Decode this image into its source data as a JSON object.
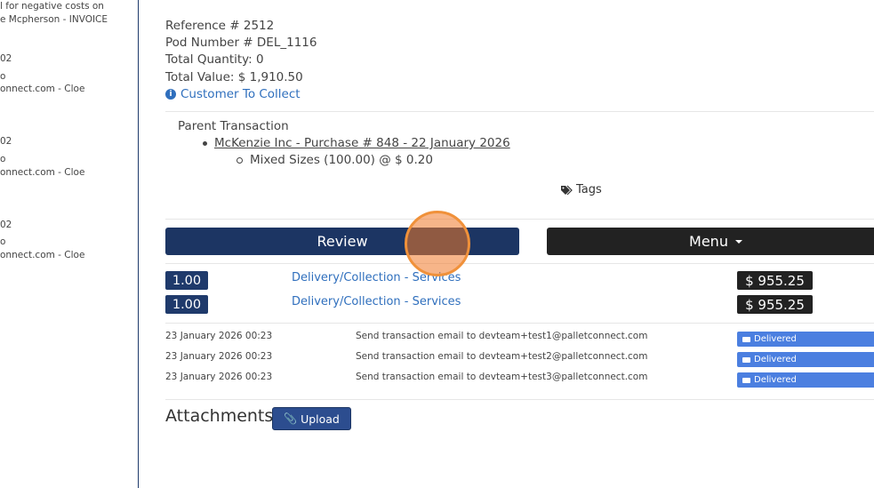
{
  "left_panel": {
    "lines": [
      "l for negative costs on",
      "e Mcpherson - INVOICE",
      "02",
      "o",
      "onnect.com - Cloe",
      "02",
      "o",
      "onnect.com - Cloe",
      "02",
      "o",
      "onnect.com - Cloe"
    ]
  },
  "details": {
    "reference": "Reference # 2512",
    "pod_number": "Pod Number # DEL_1116",
    "total_quantity": "Total Quantity: 0",
    "total_value": "Total Value: $ 1,910.50",
    "customer_collect": "Customer To Collect",
    "info_icon": "i"
  },
  "parent": {
    "heading": "Parent Transaction",
    "link": "McKenzie Inc - Purchase # 848 - 22 January 2026",
    "sub_item": "Mixed Sizes (100.00) @ $ 0.20"
  },
  "tags": {
    "label": "Tags",
    "icon": "tags-icon"
  },
  "actions": {
    "review_label": "Review",
    "menu_label": "Menu"
  },
  "line_items": [
    {
      "qty": "1.00",
      "description": "Delivery/Collection - Services",
      "price": "$ 955.25"
    },
    {
      "qty": "1.00",
      "description": "Delivery/Collection - Services",
      "price": "$ 955.25"
    }
  ],
  "email_log": [
    {
      "timestamp": "23 January 2026 00:23",
      "message": "Send transaction email to devteam+test1@palletconnect.com",
      "status": "Delivered"
    },
    {
      "timestamp": "23 January 2026 00:23",
      "message": "Send transaction email to devteam+test2@palletconnect.com",
      "status": "Delivered"
    },
    {
      "timestamp": "23 January 2026 00:23",
      "message": "Send transaction email to devteam+test3@palletconnect.com",
      "status": "Delivered"
    }
  ],
  "attachments": {
    "heading": "Attachments",
    "upload_label": "Upload"
  },
  "colors": {
    "primary": "#1c3563",
    "dark": "#222222",
    "link": "#2f6fbd",
    "delivered": "#4b7fe0",
    "cursor": "#f0913a"
  }
}
